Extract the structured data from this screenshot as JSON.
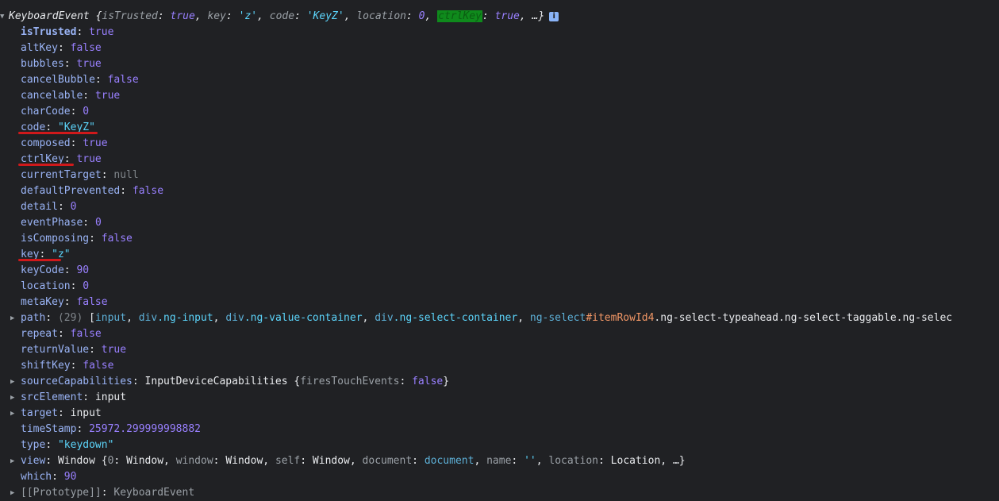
{
  "header": {
    "name": "KeyboardEvent",
    "preview": [
      {
        "key": "isTrusted",
        "value": "true",
        "type": "bool"
      },
      {
        "key": "key",
        "value": "'z'",
        "type": "str"
      },
      {
        "key": "code",
        "value": "'KeyZ'",
        "type": "str"
      },
      {
        "key": "location",
        "value": "0",
        "type": "num"
      },
      {
        "key": "ctrlKey",
        "value": "true",
        "type": "bool"
      }
    ],
    "ellipsis": "…}",
    "info_icon": "i"
  },
  "props": [
    {
      "key": "isTrusted",
      "value": "true",
      "type": "bool"
    },
    {
      "key": "altKey",
      "value": "false",
      "type": "bool"
    },
    {
      "key": "bubbles",
      "value": "true",
      "type": "bool"
    },
    {
      "key": "cancelBubble",
      "value": "false",
      "type": "bool"
    },
    {
      "key": "cancelable",
      "value": "true",
      "type": "bool"
    },
    {
      "key": "charCode",
      "value": "0",
      "type": "num"
    },
    {
      "key": "code",
      "value": "\"KeyZ\"",
      "type": "str"
    },
    {
      "key": "composed",
      "value": "true",
      "type": "bool"
    },
    {
      "key": "ctrlKey",
      "value": "true",
      "type": "bool"
    },
    {
      "key": "currentTarget",
      "value": "null",
      "type": "null"
    },
    {
      "key": "defaultPrevented",
      "value": "false",
      "type": "bool"
    },
    {
      "key": "detail",
      "value": "0",
      "type": "num"
    },
    {
      "key": "eventPhase",
      "value": "0",
      "type": "num"
    },
    {
      "key": "isComposing",
      "value": "false",
      "type": "bool"
    },
    {
      "key": "key",
      "value": "\"z\"",
      "type": "str"
    },
    {
      "key": "keyCode",
      "value": "90",
      "type": "num"
    },
    {
      "key": "location",
      "value": "0",
      "type": "num"
    },
    {
      "key": "metaKey",
      "value": "false",
      "type": "bool"
    },
    {
      "key": "path",
      "value": "(29) [input, div.ng-input, div.ng-value-container, div.ng-select-container, ng-select#itemRowId4.ng-select-typeahead.ng-select-taggable.ng-selec",
      "type": "path",
      "expandable": true
    },
    {
      "key": "repeat",
      "value": "false",
      "type": "bool"
    },
    {
      "key": "returnValue",
      "value": "true",
      "type": "bool"
    },
    {
      "key": "shiftKey",
      "value": "false",
      "type": "bool"
    },
    {
      "key": "sourceCapabilities",
      "value": "InputDeviceCapabilities {firesTouchEvents: false}",
      "type": "caps",
      "expandable": true
    },
    {
      "key": "srcElement",
      "value": "input",
      "type": "obj",
      "expandable": true
    },
    {
      "key": "target",
      "value": "input",
      "type": "obj",
      "expandable": true
    },
    {
      "key": "timeStamp",
      "value": "25972.299999998882",
      "type": "num"
    },
    {
      "key": "type",
      "value": "\"keydown\"",
      "type": "str"
    },
    {
      "key": "view",
      "value": "Window {0: Window, window: Window, self: Window, document: document, name: '', location: Location, …}",
      "type": "view",
      "expandable": true
    },
    {
      "key": "which",
      "value": "90",
      "type": "num"
    },
    {
      "key": "[[Prototype]]",
      "value": "KeyboardEvent",
      "type": "proto",
      "expandable": true
    }
  ],
  "annotations": {
    "underlined_keys": [
      "code",
      "ctrlKey",
      "key"
    ],
    "underline_color": "#d0191b",
    "highlight_color": "#0f8a1c"
  }
}
